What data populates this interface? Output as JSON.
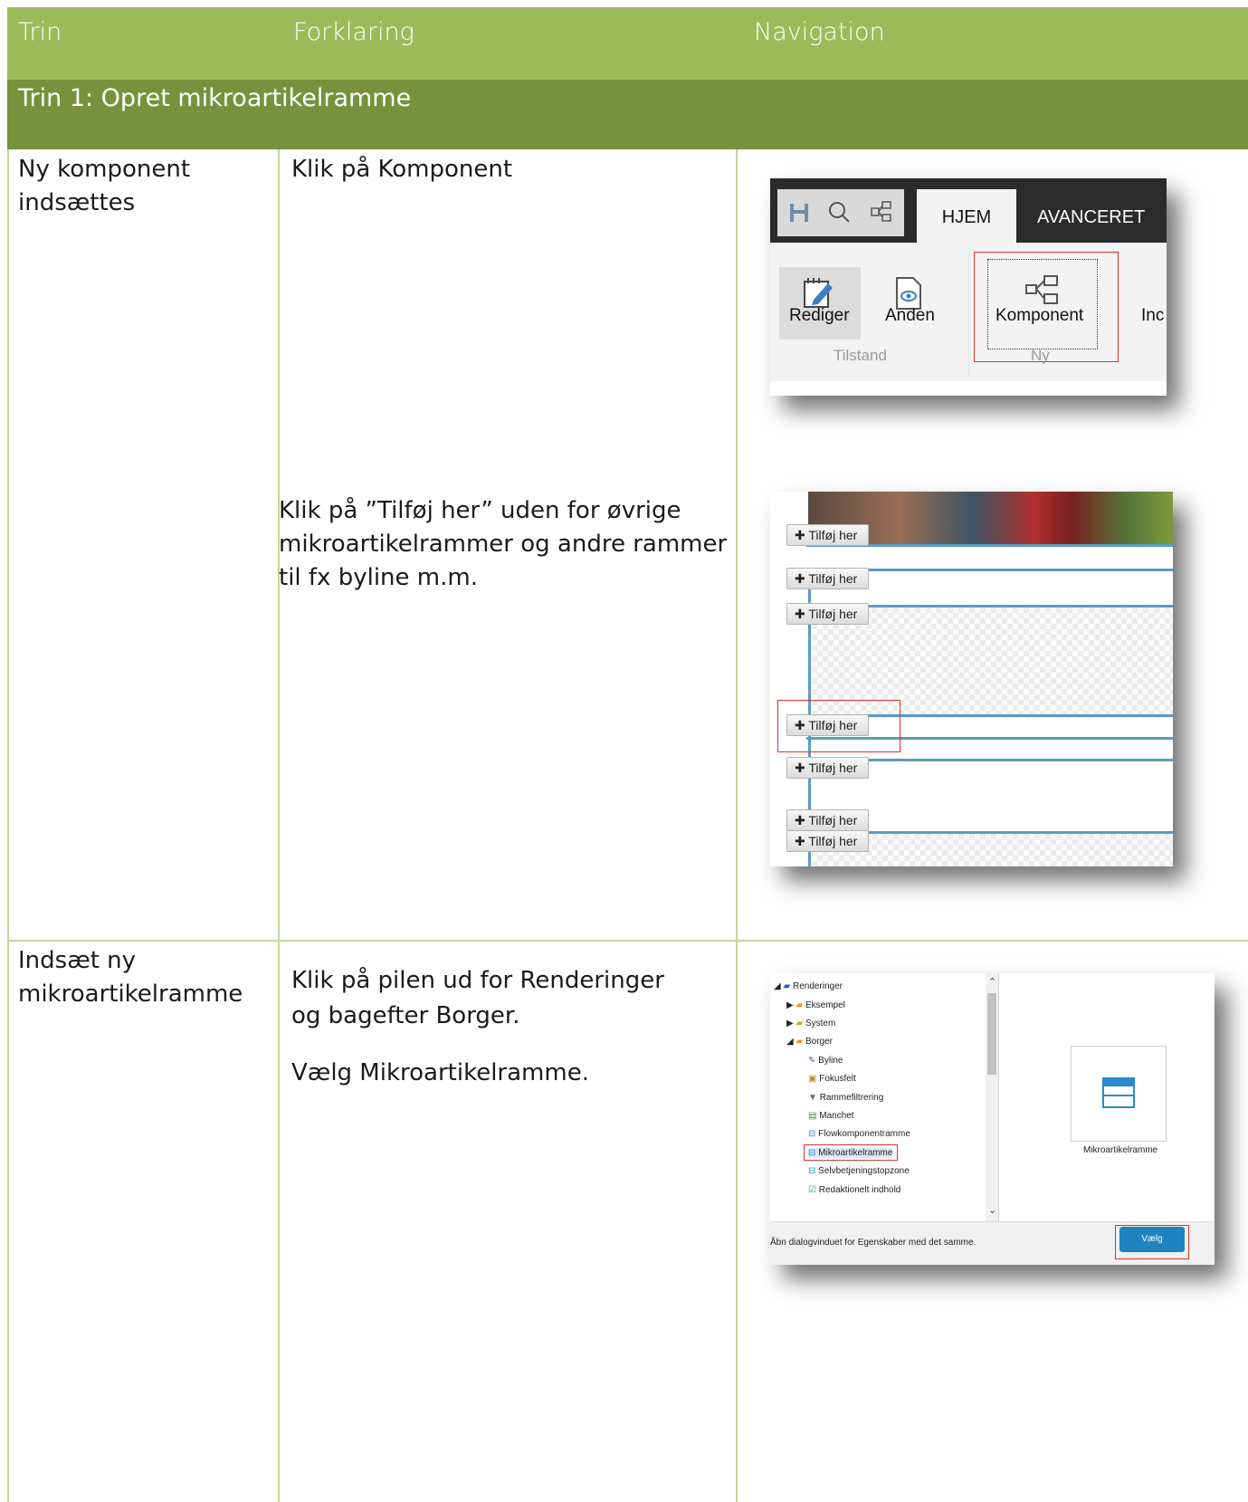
{
  "header": {
    "col1": "Trin",
    "col2": "Forklaring",
    "col3": "Navigation"
  },
  "section": {
    "title": "Trin 1: Opret mikroartikelramme"
  },
  "row1": {
    "step": "Ny komponent indsættes",
    "explain1": "Klik på Komponent",
    "explain2": "Klik på ”Tilføj her” uden for øvrige mikroartikelrammer og andre rammer til fx byline m.m."
  },
  "row2": {
    "step": "Indsæt ny mikroartikelramme",
    "explain1a": "Klik på pilen ud for Renderinger",
    "explain1b": "og bagefter Borger.",
    "explain2": "Vælg Mikroartikelramme."
  },
  "ribbon": {
    "tab_home": "HJEM",
    "tab_advanced": "AVANCERET",
    "rediger": "Rediger",
    "anden": "Anden",
    "komponent": "Komponent",
    "cut_label": "Inc",
    "group_tilstand": "Tilstand",
    "group_ny": "Ny"
  },
  "editor": {
    "add_here": "Tilføj her"
  },
  "dialog": {
    "tree": {
      "root": "Renderinger",
      "eksempel": "Eksempel",
      "system": "System",
      "borger": "Borger",
      "items": [
        "Byline",
        "Fokusfelt",
        "Rammefiltrering",
        "Manchet",
        "Flowkomponentramme",
        "Mikroartikelramme",
        "Selvbetjeningstopzone",
        "Redaktionelt indhold"
      ]
    },
    "preview_label": "Mikroartikelramme",
    "footer_text": "Åbn dialogvinduet for Egenskaber med det samme.",
    "choose_button": "Vælg"
  },
  "colors": {
    "header": "#9bbb59",
    "section": "#76923c",
    "grid": "#c3d69b",
    "highlight": "#e03030"
  }
}
